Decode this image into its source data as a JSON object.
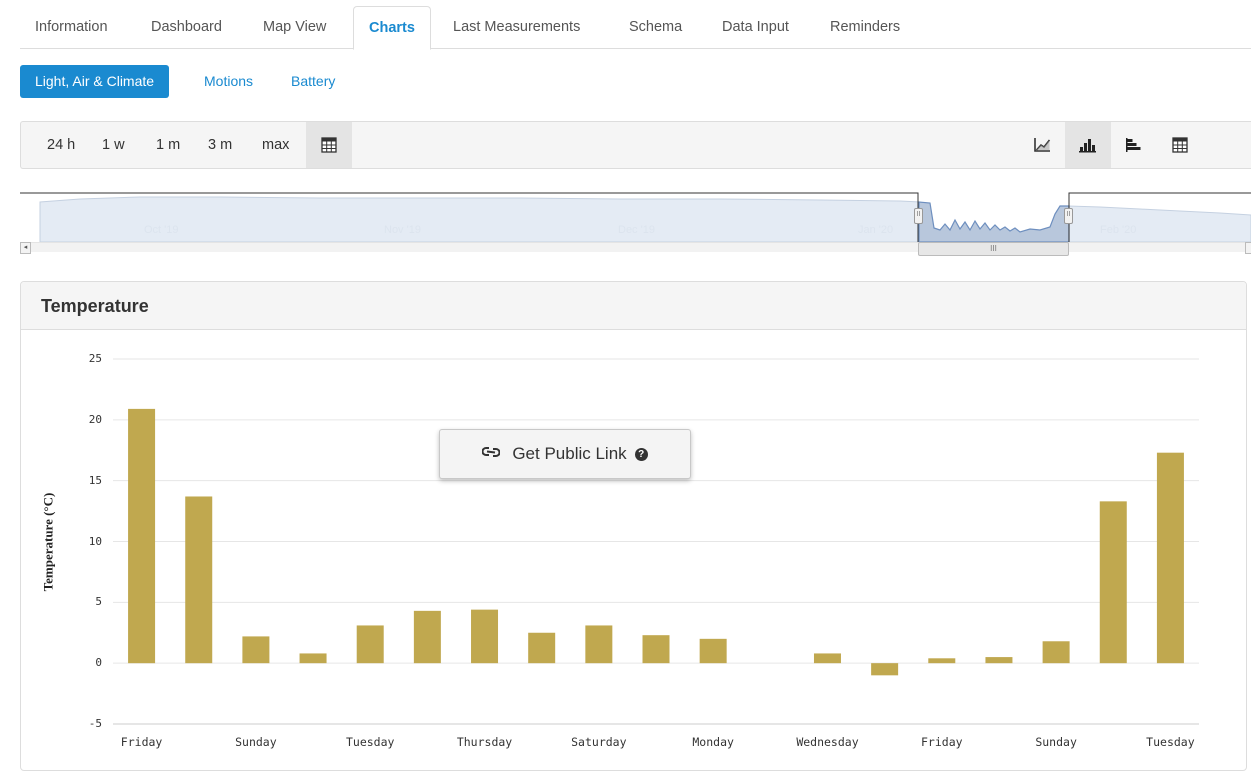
{
  "tabs": [
    {
      "label": "Information"
    },
    {
      "label": "Dashboard"
    },
    {
      "label": "Map View"
    },
    {
      "label": "Charts"
    },
    {
      "label": "Last Measurements"
    },
    {
      "label": "Schema"
    },
    {
      "label": "Data Input"
    },
    {
      "label": "Reminders"
    }
  ],
  "active_tab": "Charts",
  "subtabs": [
    {
      "label": "Light, Air & Climate"
    },
    {
      "label": "Motions"
    },
    {
      "label": "Battery"
    }
  ],
  "active_subtab": "Light, Air & Climate",
  "toolbar": {
    "ranges": [
      "24 h",
      "1 w",
      "1 m",
      "3 m",
      "max"
    ],
    "calendar_icon": "calendar-icon",
    "view_icons": [
      "line-chart-icon",
      "bar-chart-icon",
      "horizontal-bar-chart-icon",
      "table-icon"
    ],
    "active_view": "bar-chart-icon"
  },
  "navigator": {
    "months": [
      "Oct '19",
      "Nov '19",
      "Dec '19",
      "Jan '20",
      "Feb '20"
    ],
    "scroll_grip": "III",
    "handle_grip": "II"
  },
  "panel": {
    "title": "Temperature",
    "public_link_label": "Get Public Link",
    "public_link_icon": "link-icon",
    "help_icon": "question-circle-icon"
  },
  "colors": {
    "accent": "#1a8ad0",
    "bar": "#c0a84f",
    "navigator_fill": "#b8c7dc",
    "navigator_line": "#6e8fbf"
  },
  "chart_data": {
    "type": "bar",
    "ylabel": "Temperature (°C)",
    "ylim": [
      -5,
      25
    ],
    "yticks": [
      -5,
      0,
      5,
      10,
      15,
      20,
      25
    ],
    "grid": true,
    "categories": [
      "Friday",
      "Saturday",
      "Sunday",
      "Monday",
      "Tuesday",
      "Wednesday",
      "Thursday",
      "Friday",
      "Saturday",
      "Sunday",
      "Monday",
      "Tuesday",
      "Wednesday",
      "Thursday",
      "Friday",
      "Saturday",
      "Sunday",
      "Monday",
      "Tuesday"
    ],
    "xticks_shown": [
      "Friday",
      "Sunday",
      "Tuesday",
      "Thursday",
      "Saturday",
      "Monday",
      "Wednesday",
      "Friday",
      "Sunday",
      "Tuesday"
    ],
    "values": [
      20.9,
      13.7,
      2.2,
      0.8,
      3.1,
      4.3,
      4.4,
      2.5,
      3.1,
      2.3,
      2.0,
      null,
      0.8,
      -1.0,
      0.4,
      0.5,
      1.8,
      13.3,
      17.3
    ]
  }
}
